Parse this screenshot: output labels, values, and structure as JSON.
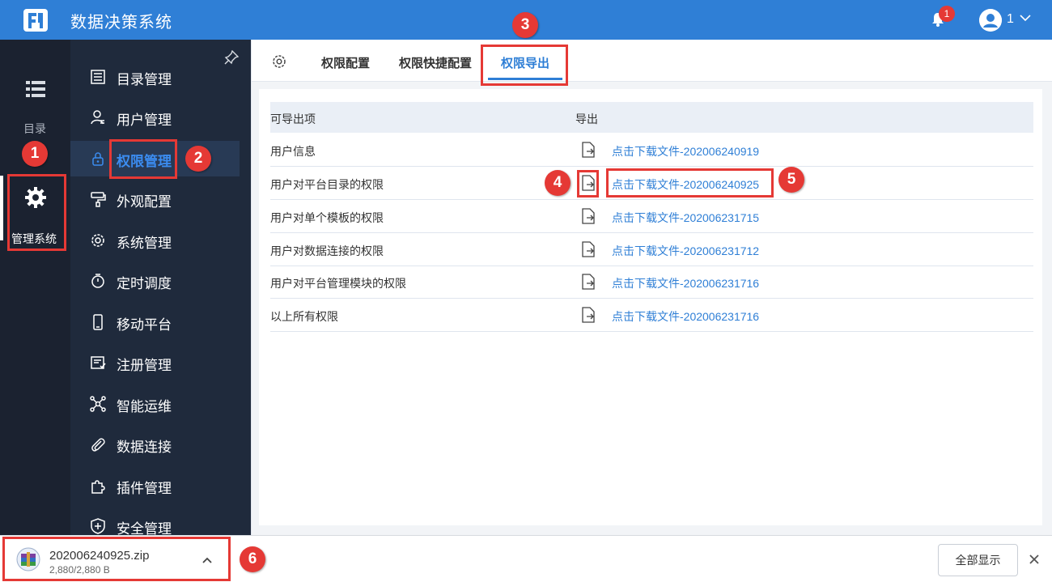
{
  "header": {
    "app_title": "数据决策系统",
    "notification_count": "1",
    "user_name": "1"
  },
  "rail": {
    "directory_label": "目录",
    "management_label": "管理系统"
  },
  "sidebar": {
    "items": [
      {
        "label": "目录管理",
        "icon": "list-icon"
      },
      {
        "label": "用户管理",
        "icon": "user-icon"
      },
      {
        "label": "权限管理",
        "icon": "lock-icon",
        "active": true
      },
      {
        "label": "外观配置",
        "icon": "paint-roller-icon"
      },
      {
        "label": "系统管理",
        "icon": "gear-icon"
      },
      {
        "label": "定时调度",
        "icon": "timer-icon"
      },
      {
        "label": "移动平台",
        "icon": "mobile-icon"
      },
      {
        "label": "注册管理",
        "icon": "register-icon"
      },
      {
        "label": "智能运维",
        "icon": "network-icon"
      },
      {
        "label": "数据连接",
        "icon": "paperclip-icon"
      },
      {
        "label": "插件管理",
        "icon": "puzzle-icon"
      },
      {
        "label": "安全管理",
        "icon": "shield-icon"
      }
    ]
  },
  "tabs": [
    {
      "label": "权限配置"
    },
    {
      "label": "权限快捷配置"
    },
    {
      "label": "权限导出",
      "active": true
    }
  ],
  "table": {
    "col_item": "可导出项",
    "col_export": "导出",
    "rows": [
      {
        "name": "用户信息",
        "link": "点击下载文件-202006240919"
      },
      {
        "name": "用户对平台目录的权限",
        "link": "点击下载文件-202006240925"
      },
      {
        "name": "用户对单个模板的权限",
        "link": "点击下载文件-202006231715"
      },
      {
        "name": "用户对数据连接的权限",
        "link": "点击下载文件-202006231712"
      },
      {
        "name": "用户对平台管理模块的权限",
        "link": "点击下载文件-202006231716"
      },
      {
        "name": "以上所有权限",
        "link": "点击下载文件-202006231716"
      }
    ]
  },
  "download": {
    "file_name": "202006240925.zip",
    "size": "2,880/2,880 B",
    "show_all": "全部显示"
  },
  "annotations": [
    "1",
    "2",
    "3",
    "4",
    "5",
    "6"
  ],
  "colors": {
    "brand": "#2f7fd6",
    "sidebar_bg": "#1f2a3c",
    "rail_bg": "#1b2230",
    "annotation": "#e53935"
  }
}
